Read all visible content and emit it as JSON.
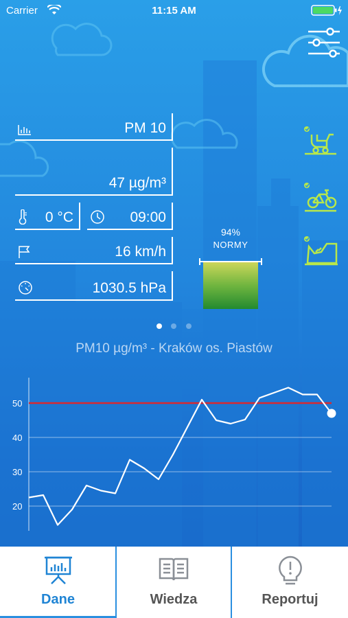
{
  "status_bar": {
    "carrier": "Carrier",
    "time": "11:15 AM"
  },
  "metrics": {
    "pollutant": "PM 10",
    "concentration": "47 µg/m³",
    "temperature": "0 °C",
    "hour": "09:00",
    "wind": "16 km/h",
    "pressure": "1030.5 hPa"
  },
  "norm_gauge": {
    "percent_label": "94%",
    "caption": "NORMY",
    "level": 0.94
  },
  "pager": {
    "pages": 3,
    "current": 0
  },
  "chart_title": "PM10 µg/m³ - Kraków os. Piastów",
  "chart_data": {
    "type": "line",
    "y_ticks": [
      "50",
      "40",
      "30",
      "20"
    ],
    "ylim": [
      13,
      60
    ],
    "threshold": 50,
    "series": [
      {
        "values": [
          22.5,
          23.2,
          14.5,
          19,
          26,
          24.5,
          23.7,
          33.5,
          31,
          27.8,
          35,
          43,
          51,
          45,
          44,
          45.2,
          51.5,
          53,
          54.5,
          52.5,
          52.5,
          47
        ]
      }
    ]
  },
  "side_icons": [
    "stroller-icon",
    "bicycle-icon",
    "running-shoe-icon"
  ],
  "colors": {
    "threshold_line": "#d9292e",
    "accent": "#1f84d4",
    "icon_green": "#b8e84a"
  },
  "tabs": [
    {
      "label": "Dane",
      "icon": "presentation-chart-icon",
      "active": true
    },
    {
      "label": "Wiedza",
      "icon": "book-icon",
      "active": false
    },
    {
      "label": "Reportuj",
      "icon": "lightbulb-alert-icon",
      "active": false
    }
  ]
}
